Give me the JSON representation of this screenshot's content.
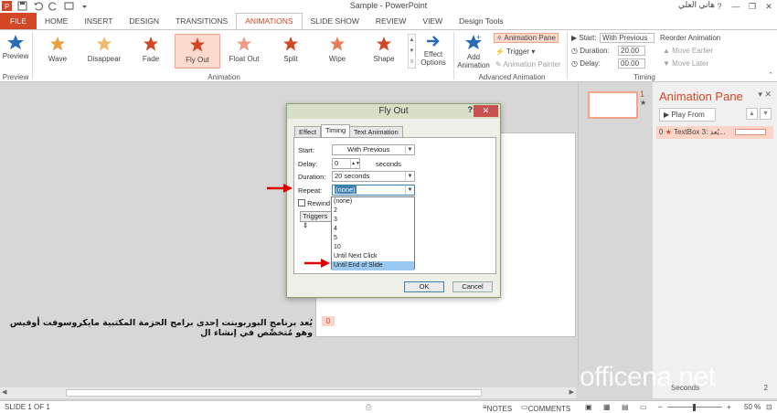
{
  "window": {
    "title": "Sample - PowerPoint",
    "user": "هاني العلي",
    "controls": [
      "?",
      "—",
      "❐",
      "✕"
    ]
  },
  "tabs": [
    "FILE",
    "HOME",
    "INSERT",
    "DESIGN",
    "TRANSITIONS",
    "ANIMATIONS",
    "SLIDE SHOW",
    "REVIEW",
    "VIEW",
    "Design Tools"
  ],
  "ribbon": {
    "preview_label": "Preview",
    "preview_group": "Preview",
    "animation_group": "Animation",
    "animations": [
      "Wave",
      "Disappear",
      "Fade",
      "Fly Out",
      "Float Out",
      "Split",
      "Wipe",
      "Shape"
    ],
    "effect_options": "Effect Options",
    "add_animation": "Add Animation",
    "animation_pane_btn": "Animation Pane",
    "trigger_btn": "Trigger",
    "animation_painter": "Animation Painter",
    "advanced_group": "Advanced Animation",
    "start_label": "Start:",
    "start_value": "With Previous",
    "duration_label": "Duration:",
    "duration_value": "20.00",
    "delay_label": "Delay:",
    "delay_value": "00.00",
    "reorder_title": "Reorder Animation",
    "move_earlier": "Move Earlier",
    "move_later": "Move Later",
    "timing_group": "Timing"
  },
  "slide": {
    "arabic_text": "يُعد برنامج البوربوينت إحدى برامج الحزمة المكتبية مايكروسوفت أوفيس وهو مُتخصِّص في إنشاء ال",
    "anim_tag": "0"
  },
  "thumbnail": {
    "number": "1",
    "star": "★"
  },
  "anim_pane": {
    "title": "Animation Pane",
    "play_from": "Play From",
    "item_index": "0",
    "item_label": "TextBox 3: يُعد...",
    "seconds_label": "Seconds",
    "seconds_value": "2"
  },
  "dialog": {
    "title": "Fly Out",
    "help": "?",
    "close": "✕",
    "tabs": [
      "Effect",
      "Timing",
      "Text Animation"
    ],
    "start_label": "Start:",
    "start_value": "With Previous",
    "delay_label": "Delay:",
    "delay_value": "0",
    "delay_unit": "seconds",
    "duration_label": "Duration:",
    "duration_value": "20 seconds",
    "repeat_label": "Repeat:",
    "repeat_value": "(none)",
    "rewind_label": "Rewind",
    "triggers_label": "Triggers",
    "repeat_options": [
      "(none)",
      "2",
      "3",
      "4",
      "5",
      "10",
      "Until Next Click",
      "Until End of Slide"
    ],
    "ok": "OK",
    "cancel": "Cancel"
  },
  "status": {
    "slide": "SLIDE 1 OF 1",
    "notes": "NOTES",
    "comments": "COMMENTS",
    "zoom": "50 %"
  },
  "watermark": "officena.net",
  "colors": {
    "accent": "#d24726",
    "selected": "#fcdacd",
    "highlight": "#99c9f1",
    "arrow": "#e00000"
  }
}
